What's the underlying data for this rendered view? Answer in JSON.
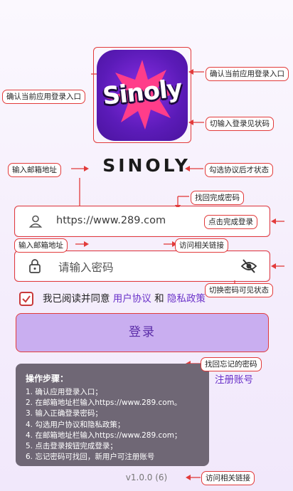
{
  "app": {
    "name": "SINOLY",
    "logo_text": "Sinoly",
    "version": "v1.0.0 (6)"
  },
  "form": {
    "email_value": "https://www.289.com",
    "password_placeholder": "请输入密码",
    "agree_prefix": "我已阅读并同意",
    "user_agreement": "用户协议",
    "and_word": "和",
    "privacy_policy": "隐私政策",
    "login_label": "登录",
    "register_label": "注册账号"
  },
  "instructions": {
    "title": "操作步骤：",
    "steps": [
      "1. 确认应用登录入口；",
      "2. 在邮箱地址栏输入https://www.289.com。",
      "3. 输入正确登录密码；",
      "4. 勾选用户协议和隐私政策；",
      "4. 在邮箱地址栏输入https://www.289.com；",
      "5. 点击登录按钮完成登录；",
      "6. 忘记密码可找回，新用户可注册账号"
    ]
  },
  "annotations": {
    "confirm_entry_left": "确认当前应用登录入口",
    "confirm_entry_right": "确认当前应用登录入口",
    "cut_login_state": "切输入登录见状码",
    "enter_email_top": "输入邮箱地址",
    "check_agreement": "勾选协议后才状态",
    "find_complete_password": "找回完成密码",
    "click_complete_login": "点击完成登录",
    "enter_email_mid": "输入邮箱地址",
    "visit_link_mid": "访问相关链接",
    "toggle_password_visible": "切换密码可见状态",
    "find_forgotten_password": "找回忘记的密码",
    "visit_link_bottom": "访问相关链接"
  },
  "colors": {
    "accent": "#6a32c9",
    "annotation_red": "#e23b3b",
    "button_bg": "#c9aef0",
    "panel_bg": "#6f6775"
  },
  "icons": [
    "user-icon",
    "lock-icon",
    "eye-off-icon",
    "check-icon"
  ]
}
